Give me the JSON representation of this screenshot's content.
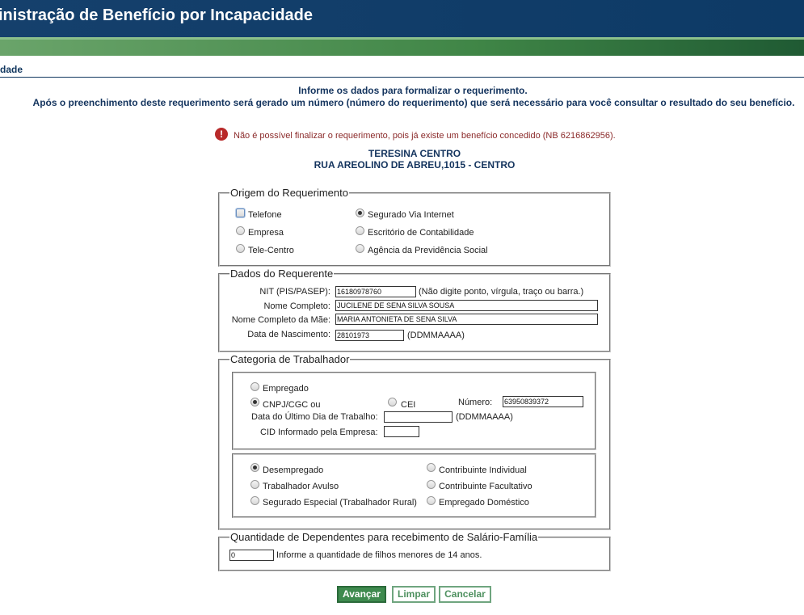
{
  "header": {
    "title": "inistração de Benefício por Incapacidade"
  },
  "section": {
    "title": "dade"
  },
  "intro": {
    "line1": "Informe os dados para formalizar o requerimento.",
    "line2": "Após o preenchimento deste requerimento será gerado um número (número do requerimento) que será necessário para você consultar o resultado do seu benefício."
  },
  "error": {
    "icon": "exclamation-icon",
    "glyph": "!",
    "message": "Não é possível finalizar o requerimento, pois já existe um benefício concedido (NB 6216862956)."
  },
  "agency": {
    "name": "TERESINA CENTRO",
    "address": "RUA AREOLINO DE ABREU,1015 - CENTRO"
  },
  "origem": {
    "legend": "Origem do Requerimento",
    "options": [
      "Telefone",
      "Segurado Via Internet",
      "Empresa",
      "Escritório de Contabilidade",
      "Tele-Centro",
      "Agência da Previdência Social"
    ],
    "selected": "Segurado Via Internet"
  },
  "requerente": {
    "legend": "Dados do Requerente",
    "nit_label": "NIT (PIS/PASEP):",
    "nit_value": "16180978760",
    "nit_hint": "(Não digite ponto, vírgula, traço ou barra.)",
    "nome_label": "Nome Completo:",
    "nome_value": "JUCILENE DE SENA SILVA SOUSA",
    "mae_label": "Nome Completo da Mãe:",
    "mae_value": "MARIA ANTONIETA DE SENA SILVA",
    "nasc_label": "Data de Nascimento:",
    "nasc_value": "28101973",
    "nasc_hint": "(DDMMAAAA)"
  },
  "categoria": {
    "legend": "Categoria de Trabalhador",
    "empregado": "Empregado",
    "cnpj": "CNPJ/CGC ou",
    "cei": "CEI",
    "numero_label": "Número:",
    "numero_value": "63950839372",
    "ultimo_dia_label": "Data do Último Dia de Trabalho:",
    "ultimo_dia_value": "",
    "ultimo_dia_hint": "(DDMMAAAA)",
    "cid_label": "CID Informado pela Empresa:",
    "cid_value": "",
    "other": {
      "desempregado": "Desempregado",
      "contribuinte_individual": "Contribuinte Individual",
      "avulso": "Trabalhador Avulso",
      "facultativo": "Contribuinte Facultativo",
      "especial": "Segurado Especial (Trabalhador Rural)",
      "domestico": "Empregado Doméstico"
    }
  },
  "dependentes": {
    "legend": "Quantidade de Dependentes para recebimento de Salário-Família",
    "value": "0",
    "hint": "Informe a quantidade de filhos menores de 14 anos."
  },
  "buttons": {
    "avancar": "Avançar",
    "limpar": "Limpar",
    "cancelar": "Cancelar"
  }
}
